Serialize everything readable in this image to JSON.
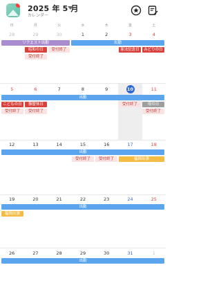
{
  "header": {
    "title": "2025 年 5 月",
    "subtitle": "カレンダー"
  },
  "weekdays": [
    "日",
    "月",
    "火",
    "水",
    "木",
    "金",
    "土"
  ],
  "weeks": [
    {
      "days": [
        "28",
        "29",
        "30",
        "1",
        "2",
        "3",
        "4"
      ]
    },
    {
      "days": [
        "5",
        "6",
        "7",
        "8",
        "9",
        "10",
        "11"
      ]
    },
    {
      "days": [
        "12",
        "13",
        "14",
        "15",
        "16",
        "17",
        "18"
      ]
    },
    {
      "days": [
        "19",
        "20",
        "21",
        "22",
        "23",
        "24",
        "25"
      ]
    },
    {
      "days": [
        "26",
        "27",
        "28",
        "29",
        "30",
        "31",
        "1"
      ]
    }
  ],
  "events": {
    "request_commute": "リクエスト出勤",
    "commute": "出勤",
    "showa_day": "昭和の日",
    "constitution_day": "憲法記念日",
    "greenery_day": "みどりの日",
    "childrens_day": "こどもの日",
    "substitute_holiday": "振替休日",
    "mothers_day": "母の日",
    "accepted_done": "受付終了",
    "fukuoka_work": "福岡出張"
  },
  "colors": {
    "accent": "#2e67d9",
    "commute": "#5aa5ee",
    "holiday": "#d9423c",
    "request": "#a98bd0",
    "accepted": "#fbe3e3",
    "trip": "#f4bc45"
  }
}
